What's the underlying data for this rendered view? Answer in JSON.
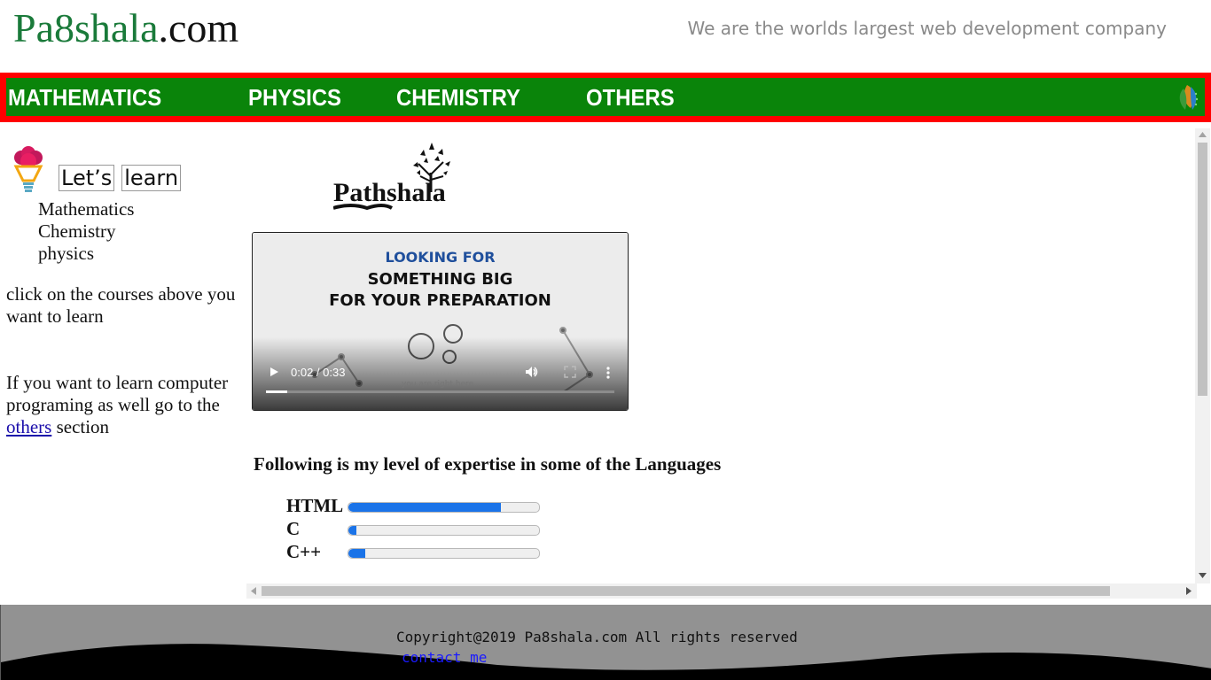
{
  "header": {
    "logo_part1": "Pa8shala",
    "logo_part2": ".com",
    "tagline": "We are the worlds largest web development company"
  },
  "nav": {
    "items": [
      "MATHEMATICS",
      "PHYSICS",
      "CHEMISTRY",
      "OTHERS"
    ],
    "bg_color": "#0a840a",
    "border_color": "#ff0000"
  },
  "sidebar": {
    "lets_learn": [
      "Let’s",
      "learn"
    ],
    "courses": [
      "Mathematics",
      "Chemistry",
      "physics"
    ],
    "click_text": "click on the courses above you want to learn",
    "programming_text": "If you want to learn computer programing as well go to the",
    "others_link": "others",
    "section_text": "section"
  },
  "main": {
    "brand_logo": "Pathshala",
    "video": {
      "line1": "LOOKING FOR",
      "line2": "SOMETHING BIG",
      "line3": "FOR YOUR PREPARATION",
      "small_text": "you are right here",
      "time": "0:02 / 0:33",
      "progress": 0.06
    },
    "expertise_title": "Following is my level of expertise in some of the Languages",
    "skills": [
      {
        "name": "HTML",
        "level": 0.8
      },
      {
        "name": "C",
        "level": 0.04
      },
      {
        "name": "C++",
        "level": 0.09
      }
    ]
  },
  "footer": {
    "copyright": "Copyright@2019 Pa8shala.com All rights reserved",
    "contact": "contact me"
  }
}
